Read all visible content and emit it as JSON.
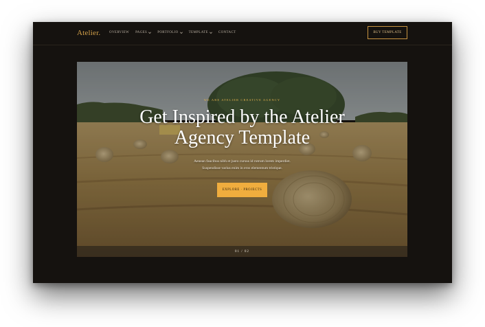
{
  "brand": {
    "logo": "Atelier."
  },
  "nav": {
    "items": [
      {
        "label": "OVERVIEW",
        "has_dropdown": false
      },
      {
        "label": "PAGES",
        "has_dropdown": true
      },
      {
        "label": "PORTFOLIO",
        "has_dropdown": true
      },
      {
        "label": "TEMPLATE",
        "has_dropdown": true
      },
      {
        "label": "CONTACT",
        "has_dropdown": false
      }
    ],
    "cta": "BUY TEMPLATE"
  },
  "hero": {
    "eyebrow": "WE ARE ATELIER CREATIVE AGENCY",
    "title_line1": "Get Inspired by the Atelier",
    "title_line2": "Agency Template",
    "subtitle_line1": "Aenean faucibus nibh et justo cursus id rutrum lorem imperdiet.",
    "subtitle_line2": "Suspendisse varius enim in eros elementum tristique.",
    "button": "EXPLORE · PROJECTS",
    "slide_counter": "01  /  02",
    "background_image": "hay-bales-field-photo"
  },
  "colors": {
    "background": "#15120f",
    "accent": "#f0ad3e",
    "logo": "#d5a24a",
    "text": "#ffffff"
  }
}
